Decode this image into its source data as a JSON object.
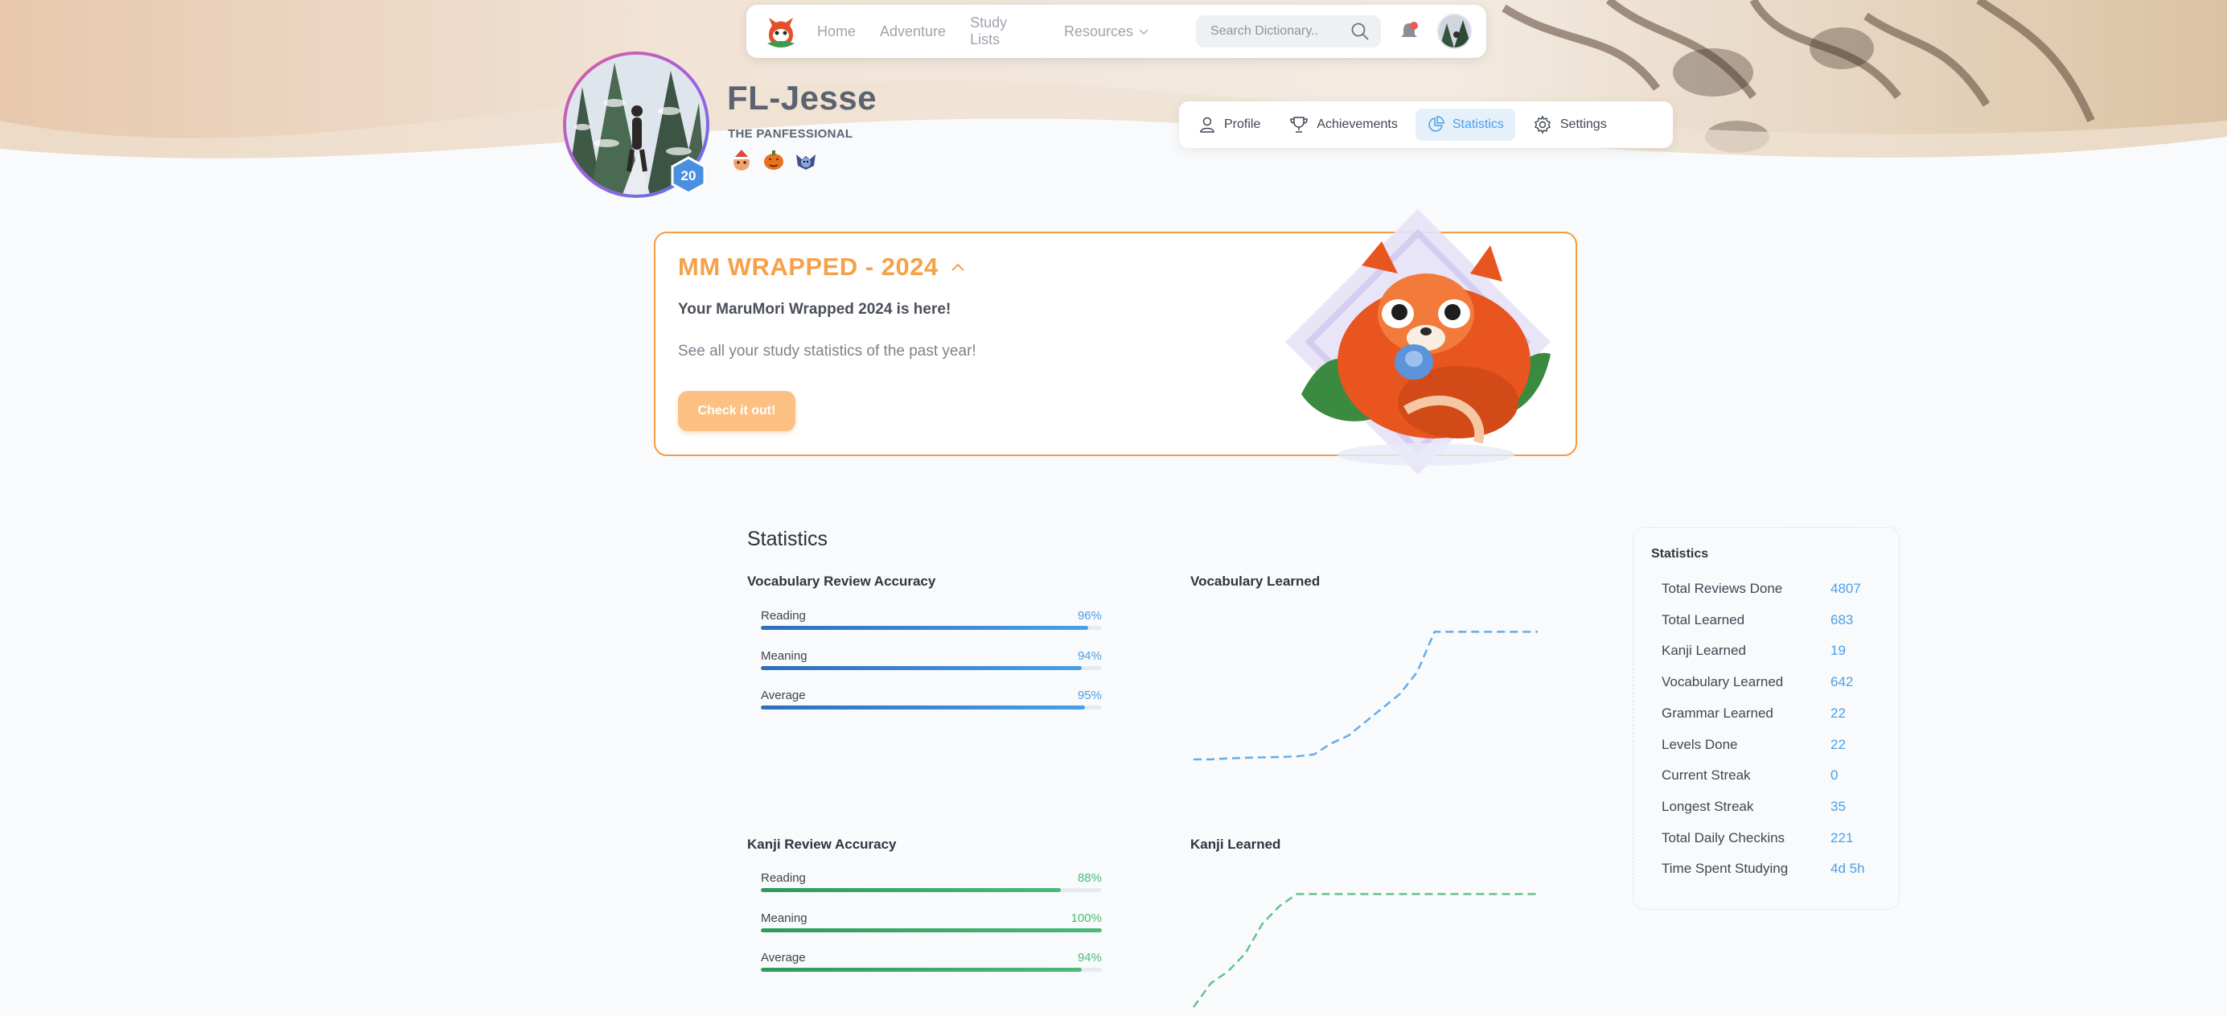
{
  "nav": {
    "links": [
      {
        "label": "Home"
      },
      {
        "label": "Adventure"
      },
      {
        "label": "Study Lists"
      },
      {
        "label": "Resources"
      }
    ],
    "search_placeholder": "Search Dictionary.."
  },
  "profile": {
    "username": "FL-Jesse",
    "title": "THE PANFESSIONAL",
    "level": "20",
    "tabs": [
      {
        "label": "Profile",
        "icon": "user-icon"
      },
      {
        "label": "Achievements",
        "icon": "trophy-icon"
      },
      {
        "label": "Statistics",
        "icon": "pie-chart-icon",
        "active": true
      },
      {
        "label": "Settings",
        "icon": "gear-icon"
      }
    ]
  },
  "wrapped": {
    "title": "MM WRAPPED - 2024",
    "headline": "Your MaruMori Wrapped 2024 is here!",
    "subtitle": "See all your study statistics of the past year!",
    "button_label": "Check it out!"
  },
  "statistics": {
    "heading": "Statistics",
    "vocab_accuracy": {
      "title": "Vocabulary Review Accuracy",
      "rows": [
        {
          "label": "Reading",
          "value": "96%",
          "fraction": 0.96
        },
        {
          "label": "Meaning",
          "value": "94%",
          "fraction": 0.94
        },
        {
          "label": "Average",
          "value": "95%",
          "fraction": 0.95
        }
      ]
    },
    "kanji_accuracy": {
      "title": "Kanji Review Accuracy",
      "rows": [
        {
          "label": "Reading",
          "value": "88%",
          "fraction": 0.88
        },
        {
          "label": "Meaning",
          "value": "100%",
          "fraction": 1.0
        },
        {
          "label": "Average",
          "value": "94%",
          "fraction": 0.94
        }
      ]
    },
    "vocab_learned_title": "Vocabulary Learned",
    "kanji_learned_title": "Kanji Learned"
  },
  "chart_data": [
    {
      "type": "line",
      "title": "Vocabulary Learned",
      "x": [
        0,
        1,
        2,
        3,
        4,
        5,
        6,
        7,
        8,
        9,
        10,
        11,
        12,
        13,
        14,
        15,
        16,
        17,
        18,
        19,
        20
      ],
      "values": [
        0,
        0,
        5,
        8,
        10,
        12,
        15,
        25,
        80,
        120,
        190,
        260,
        330,
        440,
        642,
        642,
        642,
        642,
        642,
        642,
        642
      ],
      "ylim": [
        0,
        680
      ],
      "grid": false,
      "color": "#4a9fe6"
    },
    {
      "type": "line",
      "title": "Kanji Learned",
      "x": [
        0,
        1,
        2,
        3,
        4,
        5,
        6,
        7,
        8,
        9,
        10,
        11,
        12,
        13,
        14,
        15,
        16,
        17,
        18,
        19,
        20
      ],
      "values": [
        0,
        4,
        6,
        9,
        14,
        17,
        19,
        19,
        19,
        19,
        19,
        19,
        19,
        19,
        19,
        19,
        19,
        19,
        19,
        19,
        19
      ],
      "ylim": [
        0,
        20
      ],
      "grid": false,
      "color": "#48bb78"
    }
  ],
  "side_stats": {
    "title": "Statistics",
    "rows": [
      {
        "label": "Total Reviews Done",
        "value": "4807"
      },
      {
        "label": "Total Learned",
        "value": "683"
      },
      {
        "label": "Kanji Learned",
        "value": "19"
      },
      {
        "label": "Vocabulary Learned",
        "value": "642"
      },
      {
        "label": "Grammar Learned",
        "value": "22"
      },
      {
        "label": "Levels Done",
        "value": "22"
      },
      {
        "label": "Current Streak",
        "value": "0"
      },
      {
        "label": "Longest Streak",
        "value": "35"
      },
      {
        "label": "Total Daily Checkins",
        "value": "221"
      },
      {
        "label": "Time Spent Studying",
        "value": "4d 5h"
      }
    ]
  },
  "colors": {
    "accent_blue": "#4a9fe6",
    "accent_green": "#48bb78",
    "accent_orange": "#f5a14a"
  }
}
